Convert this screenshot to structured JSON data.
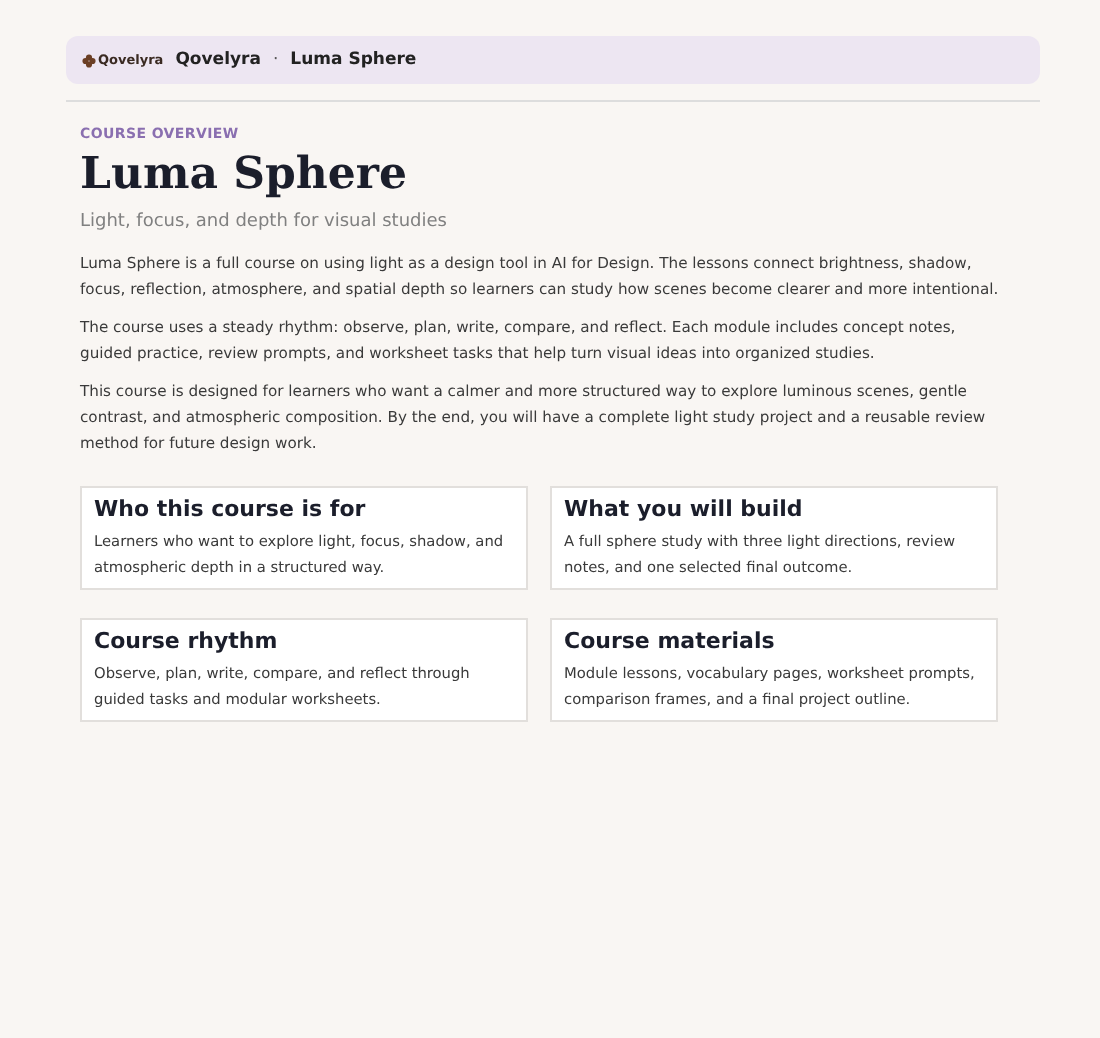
{
  "header": {
    "logo_text": "Qovelyra",
    "breadcrumb": [
      "Qovelyra",
      "Luma Sphere"
    ],
    "separator": "·"
  },
  "eyebrow": "COURSE OVERVIEW",
  "title": "Luma Sphere",
  "subtitle": "Light, focus, and depth for visual studies",
  "paragraphs": [
    "Luma Sphere is a full course on using light as a design tool in AI for Design. The lessons connect brightness, shadow, focus, reflection, atmosphere, and spatial depth so learners can study how scenes become clearer and more intentional.",
    "The course uses a steady rhythm: observe, plan, write, compare, and reflect. Each module includes concept notes, guided practice, review prompts, and worksheet tasks that help turn visual ideas into organized studies.",
    "This course is designed for learners who want a calmer and more structured way to explore luminous scenes, gentle contrast, and atmospheric composition. By the end, you will have a complete light study project and a reusable review method for future design work."
  ],
  "cards": [
    {
      "title": "Who this course is for",
      "text": "Learners who want to explore light, focus, shadow, and atmospheric depth in a structured way."
    },
    {
      "title": "What you will build",
      "text": "A full sphere study with three light directions, review notes, and one selected final outcome."
    },
    {
      "title": "Course rhythm",
      "text": "Observe, plan, write, compare, and reflect through guided tasks and modular worksheets."
    },
    {
      "title": "Course materials",
      "text": "Module lessons, vocabulary pages, worksheet prompts, comparison frames, and a final project outline."
    }
  ]
}
